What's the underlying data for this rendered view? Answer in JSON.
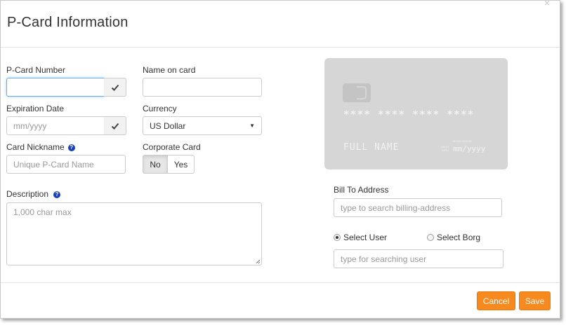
{
  "modal": {
    "title": "P-Card Information",
    "close_icon": "×"
  },
  "form": {
    "pcard_number": {
      "label": "P-Card Number",
      "value": "",
      "placeholder": ""
    },
    "name_on_card": {
      "label": "Name on card",
      "value": "",
      "placeholder": ""
    },
    "expiration_date": {
      "label": "Expiration Date",
      "placeholder": "mm/yyyy"
    },
    "currency": {
      "label": "Currency",
      "selected": "US Dollar"
    },
    "card_nickname": {
      "label": "Card Nickname",
      "placeholder": "Unique P-Card Name",
      "help": "?"
    },
    "corporate_card": {
      "label": "Corporate Card",
      "options": [
        "No",
        "Yes"
      ],
      "selected": "No"
    },
    "description": {
      "label": "Description",
      "placeholder": "1,000 char max",
      "help": "?"
    },
    "bill_to_address": {
      "label": "Bill To Address",
      "placeholder": "type to search billing-address"
    },
    "select_mode": {
      "options": [
        "Select User",
        "Select Borg"
      ],
      "selected": "Select User"
    },
    "user_search": {
      "placeholder": "type for searching user"
    }
  },
  "card_preview": {
    "number_mask": "**** **** **** ****",
    "name": "FULL NAME",
    "valid_thru_small_1": "VALID",
    "valid_thru_small_2": "THRU",
    "month_year_small": "MONTH/YEAR",
    "expiry": "mm/yyyy",
    "bg_color": "#d6d6d6"
  },
  "footer": {
    "cancel_label": "Cancel",
    "save_label": "Save",
    "accent_color": "#f68a1f"
  },
  "icons": {
    "check": "check-icon",
    "help": "help-circle-icon",
    "caret": "▼"
  }
}
